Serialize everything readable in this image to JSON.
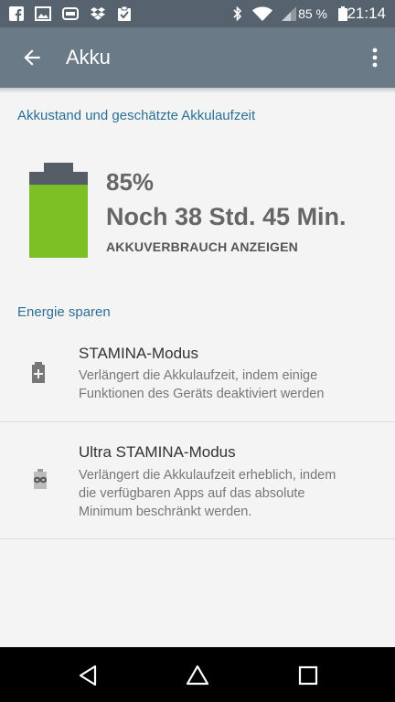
{
  "status_bar": {
    "battery_percent_label": "85 %",
    "time": "21:14",
    "notification_icons": [
      "facebook-icon",
      "image-icon",
      "cast-icon",
      "dropbox-icon",
      "clipboard-check-icon"
    ],
    "system_icons": [
      "bluetooth-icon",
      "wifi-icon",
      "signal-icon",
      "battery-icon"
    ]
  },
  "app_bar": {
    "title": "Akku"
  },
  "battery_section": {
    "header": "Akkustand und geschätzte Akkulaufzeit",
    "percent": "85%",
    "remaining": "Noch 38 Std. 45 Min.",
    "usage_link": "AKKUVERBRAUCH ANZEIGEN",
    "level": 0.85,
    "battery_color": "#7cc025"
  },
  "energy_section": {
    "header": "Energie sparen",
    "items": [
      {
        "title": "STAMINA-Modus",
        "subtitle_lines": [
          "Verlängert die Akkulaufzeit, indem einige",
          "Funktionen des Geräts deaktiviert werden"
        ]
      },
      {
        "title": "Ultra STAMINA-Modus",
        "subtitle_lines": [
          "Verlängert die Akkulaufzeit erheblich, indem",
          "die verfügbaren Apps auf das absolute",
          "Minimum beschränkt werden."
        ]
      }
    ]
  },
  "colors": {
    "status_bar": "#56626d",
    "app_bar": "#6b7a87",
    "section_header": "#2a6f97"
  }
}
